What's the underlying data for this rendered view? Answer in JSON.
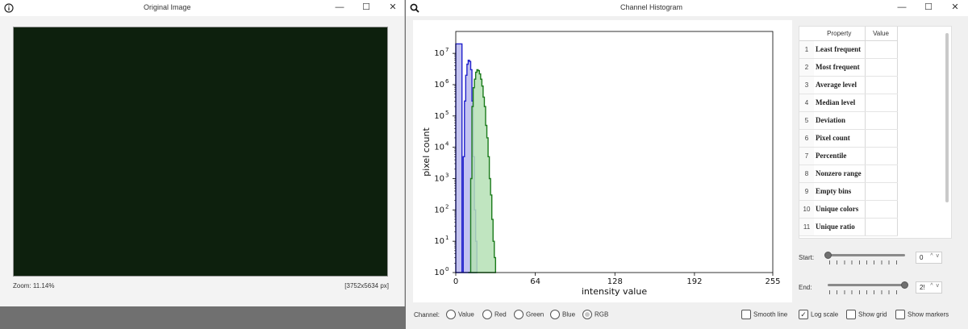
{
  "left_window": {
    "title": "Original Image",
    "info_icon": "info-icon",
    "minimize": "—",
    "maximize": "☐",
    "close": "✕",
    "zoom_text": "Zoom:  11.14%",
    "dimensions_text": "[3752x5634 px]",
    "image_color": "#0d200d"
  },
  "right_window": {
    "title": "Channel Histogram",
    "search_icon": "search-icon",
    "minimize": "—",
    "maximize": "☐",
    "close": "✕"
  },
  "chart_data": {
    "type": "area",
    "xlabel": "intensity value",
    "ylabel": "pixel count",
    "xlim": [
      0,
      255
    ],
    "ylim": [
      1,
      50000000
    ],
    "yscale": "log",
    "x_ticks": [
      "0",
      "64",
      "128",
      "192",
      "255"
    ],
    "x_tick_values": [
      0,
      64,
      128,
      192,
      255
    ],
    "y_ticks": [
      "10",
      "10",
      "10",
      "10",
      "10",
      "10",
      "10",
      "10"
    ],
    "y_tick_exponents": [
      "0",
      "1",
      "2",
      "3",
      "4",
      "5",
      "6",
      "7"
    ],
    "y_tick_values": [
      1,
      10,
      100,
      1000,
      10000,
      100000,
      1000000,
      10000000
    ],
    "series": [
      {
        "color": "#2222cc",
        "fill": "#b8b8ee",
        "x": [
          0,
          5,
          6,
          7,
          8,
          9,
          10,
          11,
          12,
          13,
          14,
          15,
          16,
          17
        ],
        "y": [
          20000000,
          1,
          5000,
          300000,
          2000000,
          4500000,
          6000000,
          5500000,
          3000000,
          300000,
          5000,
          100,
          10,
          1
        ]
      },
      {
        "color": "#1a7a1a",
        "fill": "#b5e0b5",
        "x": [
          10,
          12,
          13,
          14,
          15,
          16,
          17,
          18,
          19,
          20,
          21,
          22,
          23,
          24,
          25,
          26,
          27,
          28,
          29,
          30,
          31,
          32
        ],
        "y": [
          1,
          1000,
          200000,
          800000,
          1500000,
          2500000,
          3000000,
          2800000,
          2200000,
          1500000,
          900000,
          400000,
          200000,
          50000,
          20000,
          5000,
          1000,
          300,
          50,
          10,
          3,
          1
        ]
      }
    ]
  },
  "properties": {
    "headers": [
      "Property",
      "Value"
    ],
    "rows": [
      {
        "index": "1",
        "name": "Least frequent",
        "value": ""
      },
      {
        "index": "2",
        "name": "Most frequent",
        "value": ""
      },
      {
        "index": "3",
        "name": "Average level",
        "value": ""
      },
      {
        "index": "4",
        "name": "Median level",
        "value": ""
      },
      {
        "index": "5",
        "name": "Deviation",
        "value": ""
      },
      {
        "index": "6",
        "name": "Pixel count",
        "value": ""
      },
      {
        "index": "7",
        "name": "Percentile",
        "value": ""
      },
      {
        "index": "8",
        "name": "Nonzero range",
        "value": ""
      },
      {
        "index": "9",
        "name": "Empty bins",
        "value": ""
      },
      {
        "index": "10",
        "name": "Unique colors",
        "value": ""
      },
      {
        "index": "11",
        "name": "Unique ratio",
        "value": ""
      }
    ]
  },
  "sliders": {
    "start_label": "Start:",
    "start_value": "0",
    "start_fraction": 0.0,
    "end_label": "End:",
    "end_value": "2!",
    "end_fraction": 1.0,
    "spin_arrows": "^ v"
  },
  "channel": {
    "label": "Channel:",
    "options": [
      "Value",
      "Red",
      "Green",
      "Blue",
      "RGB"
    ],
    "selected": "RGB"
  },
  "toggles": {
    "smooth_line": {
      "label": "Smooth line",
      "checked": false
    },
    "log_scale": {
      "label": "Log scale",
      "checked": true
    },
    "show_grid": {
      "label": "Show grid",
      "checked": false
    },
    "show_markers": {
      "label": "Show markers",
      "checked": false
    }
  }
}
